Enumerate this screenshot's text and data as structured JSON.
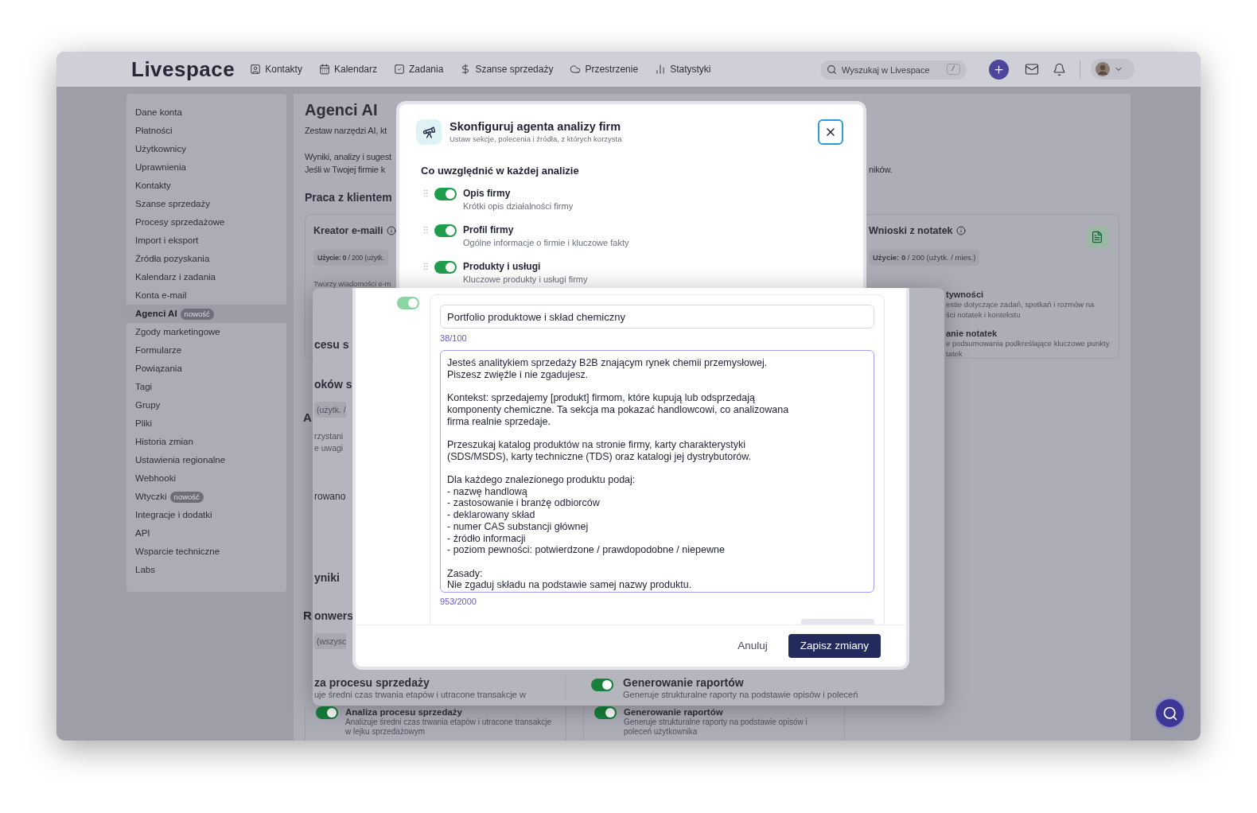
{
  "nav": {
    "logo": "Livespace",
    "items": [
      {
        "label": "Kontakty"
      },
      {
        "label": "Kalendarz"
      },
      {
        "label": "Zadania"
      },
      {
        "label": "Szanse sprzedaży"
      },
      {
        "label": "Przestrzenie"
      },
      {
        "label": "Statystyki"
      }
    ],
    "search": {
      "placeholder": "Wyszukaj w Livespace",
      "shortcut": "/"
    }
  },
  "sidebar": {
    "items": [
      {
        "label": "Dane konta",
        "selected": false
      },
      {
        "label": "Płatności",
        "selected": false
      },
      {
        "label": "Użytkownicy",
        "selected": false
      },
      {
        "label": "Uprawnienia",
        "selected": false
      },
      {
        "label": "Kontakty",
        "selected": false
      },
      {
        "label": "Szanse sprzedaży",
        "selected": false
      },
      {
        "label": "Procesy sprzedażowe",
        "selected": false
      },
      {
        "label": "Import i eksport",
        "selected": false
      },
      {
        "label": "Źródła pozyskania",
        "selected": false
      },
      {
        "label": "Kalendarz i zadania",
        "selected": false
      },
      {
        "label": "Konta e-mail",
        "selected": false
      },
      {
        "label": "Agenci AI",
        "selected": true,
        "badge": "nowość"
      },
      {
        "label": "Zgody marketingowe",
        "selected": false
      },
      {
        "label": "Formularze",
        "selected": false
      },
      {
        "label": "Powiązania",
        "selected": false
      },
      {
        "label": "Tagi",
        "selected": false
      },
      {
        "label": "Grupy",
        "selected": false
      },
      {
        "label": "Pliki",
        "selected": false
      },
      {
        "label": "Historia zmian",
        "selected": false
      },
      {
        "label": "Ustawienia regionalne",
        "selected": false
      },
      {
        "label": "Webhooki",
        "selected": false
      },
      {
        "label": "Wtyczki",
        "selected": false,
        "badge": "nowość"
      },
      {
        "label": "Integracje i dodatki",
        "selected": false
      },
      {
        "label": "API",
        "selected": false
      },
      {
        "label": "Wsparcie techniczne",
        "selected": false
      },
      {
        "label": "Labs",
        "selected": false
      }
    ]
  },
  "page": {
    "title": "Agenci AI",
    "intro": "Zestaw narzędzi AI, kt",
    "notes": [
      "Wyniki, analizy i sugest",
      "Jeśli w Twojej firmie k"
    ],
    "notes_tail": "ników.",
    "section_title": "Praca z klientem",
    "cut_letters": [
      "A",
      "R"
    ],
    "left_card": {
      "title": "Kreator e-maili",
      "usage": "**Użycie: 0** / 200 (użytk.",
      "description": "Tworzy wiadomości e-m"
    },
    "right_card": {
      "title": "Wnioski z notatek",
      "usage": "**Użycie: 0** / 200 (użytk. / mies.)",
      "lines": [
        {
          "text": "tywności",
          "kind": "title"
        },
        {
          "text": "estie dotyczące zadań, spotkań i rozmów na",
          "kind": "text"
        },
        {
          "text": "ści notatek i kontekstu",
          "kind": "text"
        },
        {
          "text": "anie notatek",
          "kind": "title"
        },
        {
          "text": "e podsumowania podkreślające kluczowe punkty",
          "kind": "text"
        },
        {
          "text": "tatek",
          "kind": "text"
        }
      ]
    },
    "bottom_cards": [
      {
        "on": true,
        "title": "Analiza procesu sprzedaży",
        "description": "Analizuje średni czas trwania etapów i utracone transakcje w lejku sprzedażowym"
      },
      {
        "on": true,
        "title": "Generowanie raportów",
        "description": "Generuje strukturalne raporty na podstawie opisów i poleceń użytkownika"
      }
    ]
  },
  "config_modal": {
    "title": "Skonfiguruj agenta analizy firm",
    "subtitle": "Ustaw sekcje, polecenia i źródła, z których korzysta",
    "section_title": "Co uwzględnić w każdej analizie",
    "sections": [
      {
        "title": "Opis firmy",
        "description": "Krótki opis działalności firmy",
        "on": true
      },
      {
        "title": "Profil firmy",
        "description": "Ogólne informacje o firmie i kluczowe fakty",
        "on": true
      },
      {
        "title": "Produkty i usługi",
        "description": "Kluczowe produkty i usługi firmy",
        "on": true
      }
    ]
  },
  "zoom_panel": {
    "fragments": [
      {
        "text": "cesu s",
        "kind": "heading"
      },
      {
        "text": "oków s",
        "kind": "heading"
      },
      {
        "text": "(użytk. /",
        "kind": "pill"
      },
      {
        "text": "rzystani",
        "kind": "text"
      },
      {
        "text": "e uwagi",
        "kind": "text"
      },
      {
        "text": "rowano",
        "kind": "label"
      },
      {
        "text": "yniki",
        "kind": "heading"
      },
      {
        "text": "onwers",
        "kind": "heading"
      },
      {
        "text": "(wszysc",
        "kind": "pill"
      }
    ],
    "bottom_items": [
      {
        "kind": "cut",
        "title": "za procesu sprzedaży",
        "description": "uje średni czas trwania etapów i utracone transakcje w"
      },
      {
        "kind": "toggle",
        "on": true,
        "title": "Generowanie raportów",
        "description": "Generuje strukturalne raporty na podstawie opisów i poleceń"
      }
    ]
  },
  "edit_modal": {
    "section_on": true,
    "name": {
      "value": "Portfolio produktowe i skład chemiczny",
      "counter": "38/100"
    },
    "prompt": {
      "value": "Jesteś analitykiem sprzedaży B2B znającym rynek chemii przemysłowej.\nPiszesz zwięźle i nie zgadujesz.\n\nKontekst: sprzedajemy [produkt] firmom, które kupują lub odsprzedają\nkomponenty chemiczne. Ta sekcja ma pokazać handlowcowi, co analizowana\nfirma realnie sprzedaje.\n\nPrzeszukaj katalog produktów na stronie firmy, karty charakterystyki\n(SDS/MSDS), karty techniczne (TDS) oraz katalogi jej dystrybutorów.\n\nDla każdego znalezionego produktu podaj:\n- nazwę handlową\n- zastosowanie i branżę odbiorców\n- deklarowany skład\n- numer CAS substancji głównej\n- źródło informacji\n- poziom pewności: potwierdzone / prawdopodobne / niepewne\n\nZasady:\nNie zgaduj składu na podstawie samej nazwy produktu.",
      "counter": "953/2000"
    },
    "cancel": "Anuluj",
    "save": "Zapisz zmiany"
  }
}
